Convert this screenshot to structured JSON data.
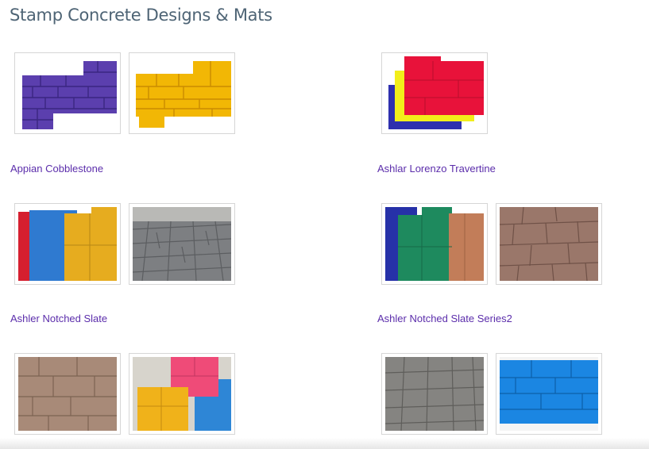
{
  "page": {
    "title": "Stamp Concrete Designs & Mats"
  },
  "products": [
    {
      "name": "Appian Cobblestone"
    },
    {
      "name": "Ashlar Lorenzo Travertine"
    },
    {
      "name": "Ashler Notched Slate"
    },
    {
      "name": "Ashler Notched Slate Series2"
    }
  ],
  "colors": {
    "title": "#4e6475",
    "link": "#5b2dab",
    "thumb_border": "#d6d6d6"
  }
}
